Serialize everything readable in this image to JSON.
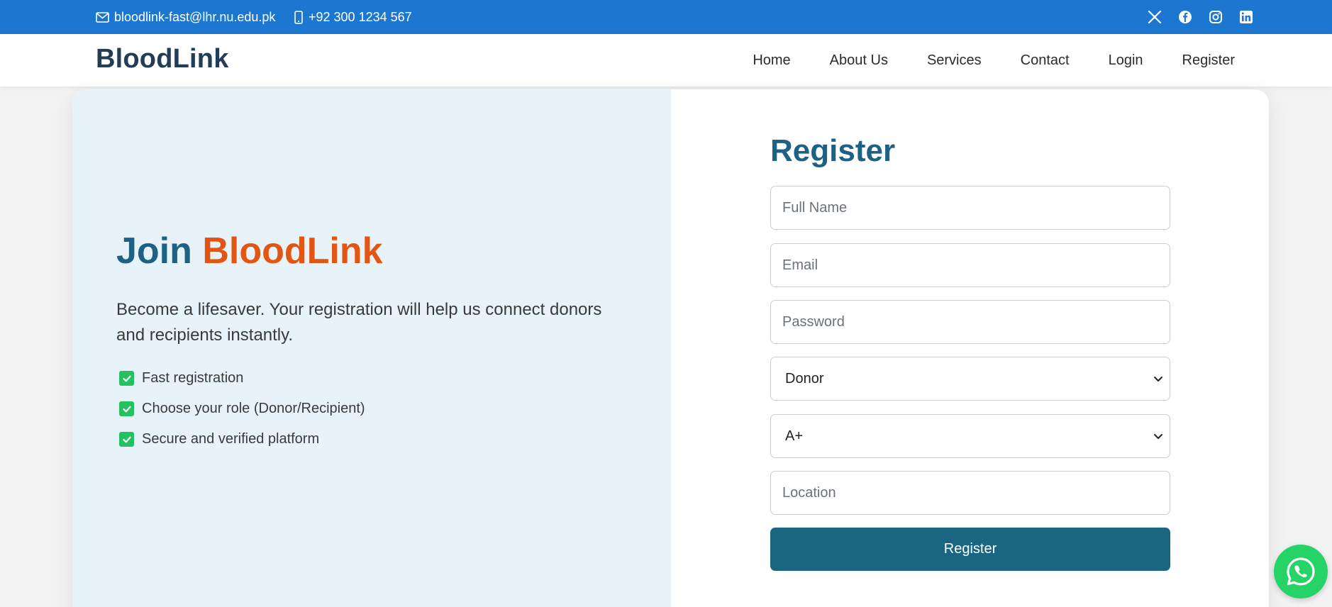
{
  "topbar": {
    "email": "bloodlink-fast@lhr.nu.edu.pk",
    "phone": "+92 300 1234 567",
    "socials": [
      "x-icon",
      "facebook-icon",
      "instagram-icon",
      "linkedin-icon"
    ]
  },
  "navbar": {
    "logo": "BloodLink",
    "links": [
      "Home",
      "About Us",
      "Services",
      "Contact",
      "Login",
      "Register"
    ]
  },
  "left_panel": {
    "title_part1": "Join",
    "title_part2": "BloodLink",
    "intro": "Become a lifesaver. Your registration will help us connect donors and recipients instantly.",
    "features": [
      "Fast registration",
      "Choose your role (Donor/Recipient)",
      "Secure and verified platform"
    ]
  },
  "form": {
    "title": "Register",
    "full_name_placeholder": "Full Name",
    "email_placeholder": "Email",
    "password_placeholder": "Password",
    "role_selected": "Donor",
    "blood_group_selected": "A+",
    "location_placeholder": "Location",
    "submit_label": "Register"
  },
  "colors": {
    "topbar_bg": "#1b77cf",
    "logo": "#233d58",
    "primary": "#1d6284",
    "accent_orange": "#e35512",
    "left_panel_bg": "#e8f2f9",
    "button_bg": "#196682",
    "check_green": "#25c161",
    "whatsapp_green": "#25d366"
  }
}
